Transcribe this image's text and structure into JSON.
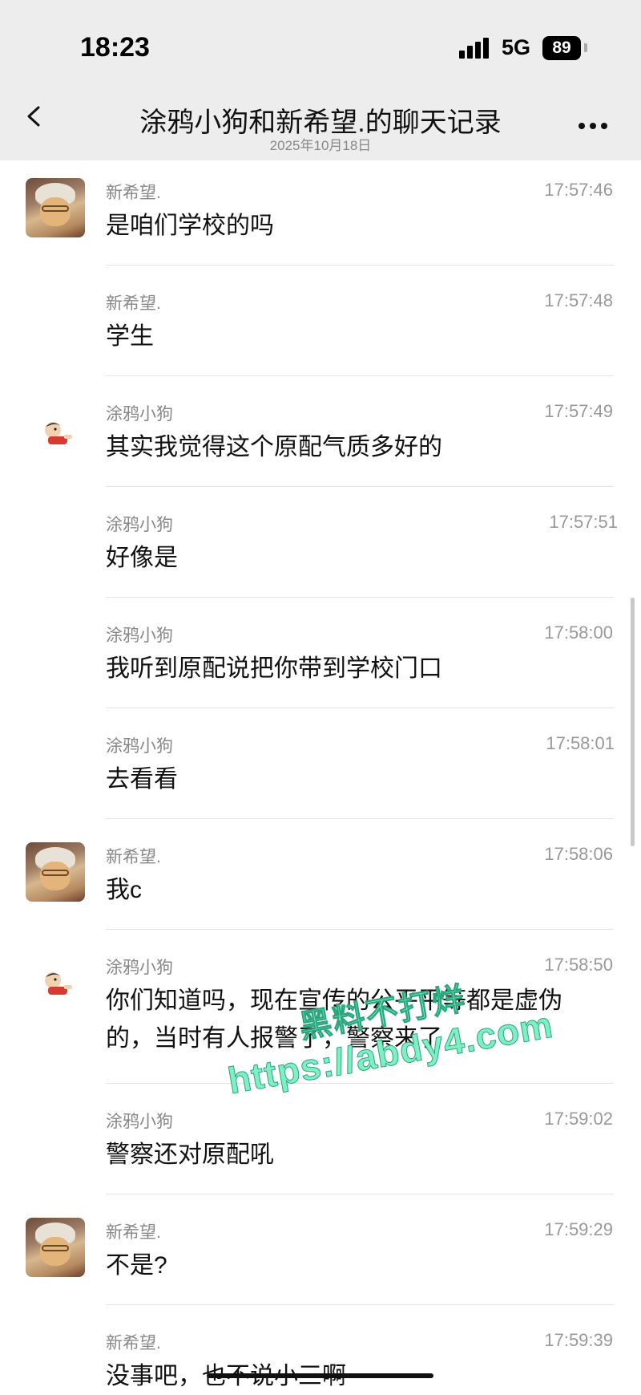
{
  "status_bar": {
    "time": "18:23",
    "network": "5G",
    "battery": "89"
  },
  "header": {
    "title": "涂鸦小狗和新希望.的聊天记录",
    "subtitle": "2025年10月18日"
  },
  "messages": [
    {
      "sender": "新希望.",
      "time": "17:57:46",
      "text": "是咱们学校的吗",
      "avatar": "elderly-avatar"
    },
    {
      "sender": "新希望.",
      "time": "17:57:48",
      "text": "学生"
    },
    {
      "sender": "涂鸦小狗",
      "time": "17:57:49",
      "text": "其实我觉得这个原配气质多好的",
      "avatar": "cartoon-kid-avatar"
    },
    {
      "sender": "涂鸦小狗",
      "time": "17:57:51",
      "text": "好像是"
    },
    {
      "sender": "涂鸦小狗",
      "time": "17:58:00",
      "text": "我听到原配说把你带到学校门口"
    },
    {
      "sender": "涂鸦小狗",
      "time": "17:58:01",
      "text": "去看看"
    },
    {
      "sender": "新希望.",
      "time": "17:58:06",
      "text": "我c",
      "avatar": "elderly-avatar"
    },
    {
      "sender": "涂鸦小狗",
      "time": "17:58:50",
      "text_line1": "你们知道吗，现在宣传的公平平等都是虚伪",
      "text_line2": "的，当时有人报警了，警察来了",
      "avatar": "cartoon-kid-avatar"
    },
    {
      "sender": "涂鸦小狗",
      "time": "17:59:02",
      "text": "警察还对原配吼"
    },
    {
      "sender": "新希望.",
      "time": "17:59:29",
      "text": "不是?",
      "avatar": "elderly-avatar"
    },
    {
      "sender": "新希望.",
      "time": "17:59:39",
      "text": "没事吧，",
      "struck_text": "也不说小三啊"
    }
  ],
  "watermark": {
    "line1": "黑料不打烊",
    "line2": "https://abdy4.com"
  }
}
